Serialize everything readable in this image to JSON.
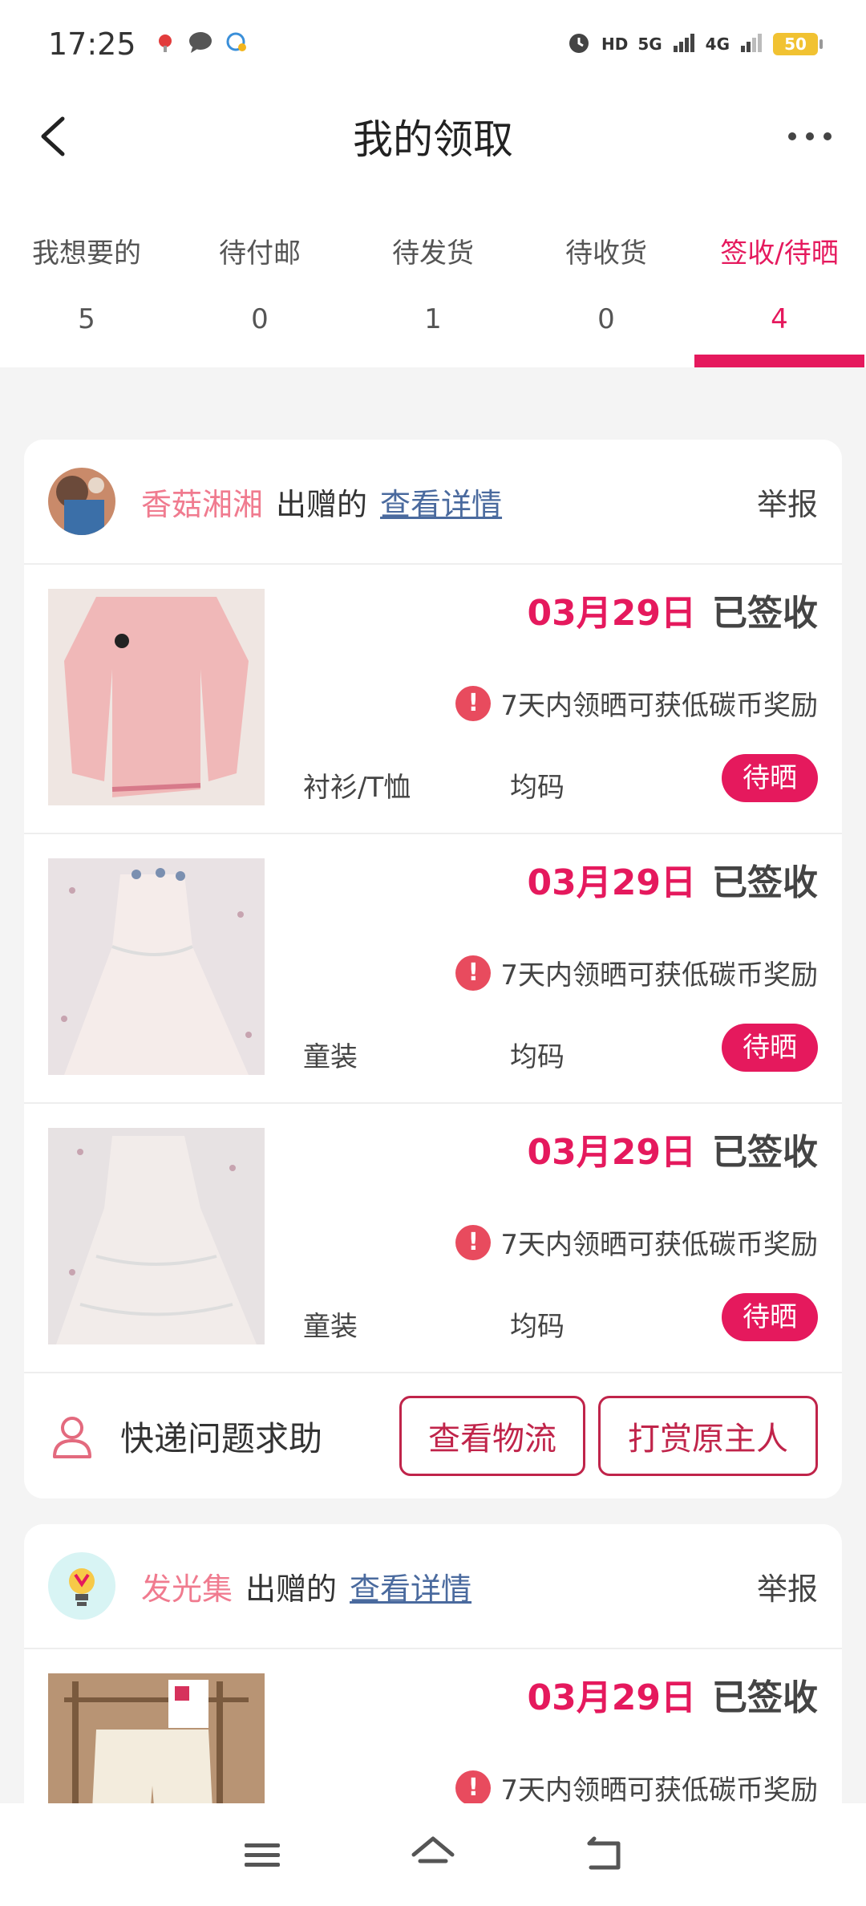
{
  "status_bar": {
    "time": "17:25",
    "hd_label": "HD",
    "net1": "5G",
    "net2": "4G",
    "battery": "50"
  },
  "header": {
    "title": "我的领取",
    "back_icon": "back-arrow-icon",
    "more_icon": "more-dots-icon"
  },
  "tabs": [
    {
      "label": "我想要的",
      "count": "5"
    },
    {
      "label": "待付邮",
      "count": "0"
    },
    {
      "label": "待发货",
      "count": "1"
    },
    {
      "label": "待收货",
      "count": "0"
    },
    {
      "label": "签收/待晒",
      "count": "4",
      "active": true
    }
  ],
  "cards": [
    {
      "giver": "香菇湘湘",
      "suffix": "出赠的",
      "detail_link": "查看详情",
      "report": "举报",
      "items": [
        {
          "date": "03月29日",
          "state": "已签收",
          "notice": "7天内领晒可获低碳币奖励",
          "category": "衬衫/T恤",
          "size": "均码",
          "status_btn": "待晒"
        },
        {
          "date": "03月29日",
          "state": "已签收",
          "notice": "7天内领晒可获低碳币奖励",
          "category": "童装",
          "size": "均码",
          "status_btn": "待晒"
        },
        {
          "date": "03月29日",
          "state": "已签收",
          "notice": "7天内领晒可获低碳币奖励",
          "category": "童装",
          "size": "均码",
          "status_btn": "待晒"
        }
      ],
      "footer": {
        "help_label": "快递问题求助",
        "logistics_btn": "查看物流",
        "tip_btn": "打赏原主人"
      }
    },
    {
      "giver": "发光集",
      "suffix": "出赠的",
      "detail_link": "查看详情",
      "report": "举报",
      "items": [
        {
          "date": "03月29日",
          "state": "已签收",
          "notice": "7天内领晒可获低碳币奖励"
        }
      ]
    }
  ],
  "colors": {
    "accent": "#e5195d",
    "giver_name": "#f07b8f",
    "link": "#4a6a9e"
  }
}
